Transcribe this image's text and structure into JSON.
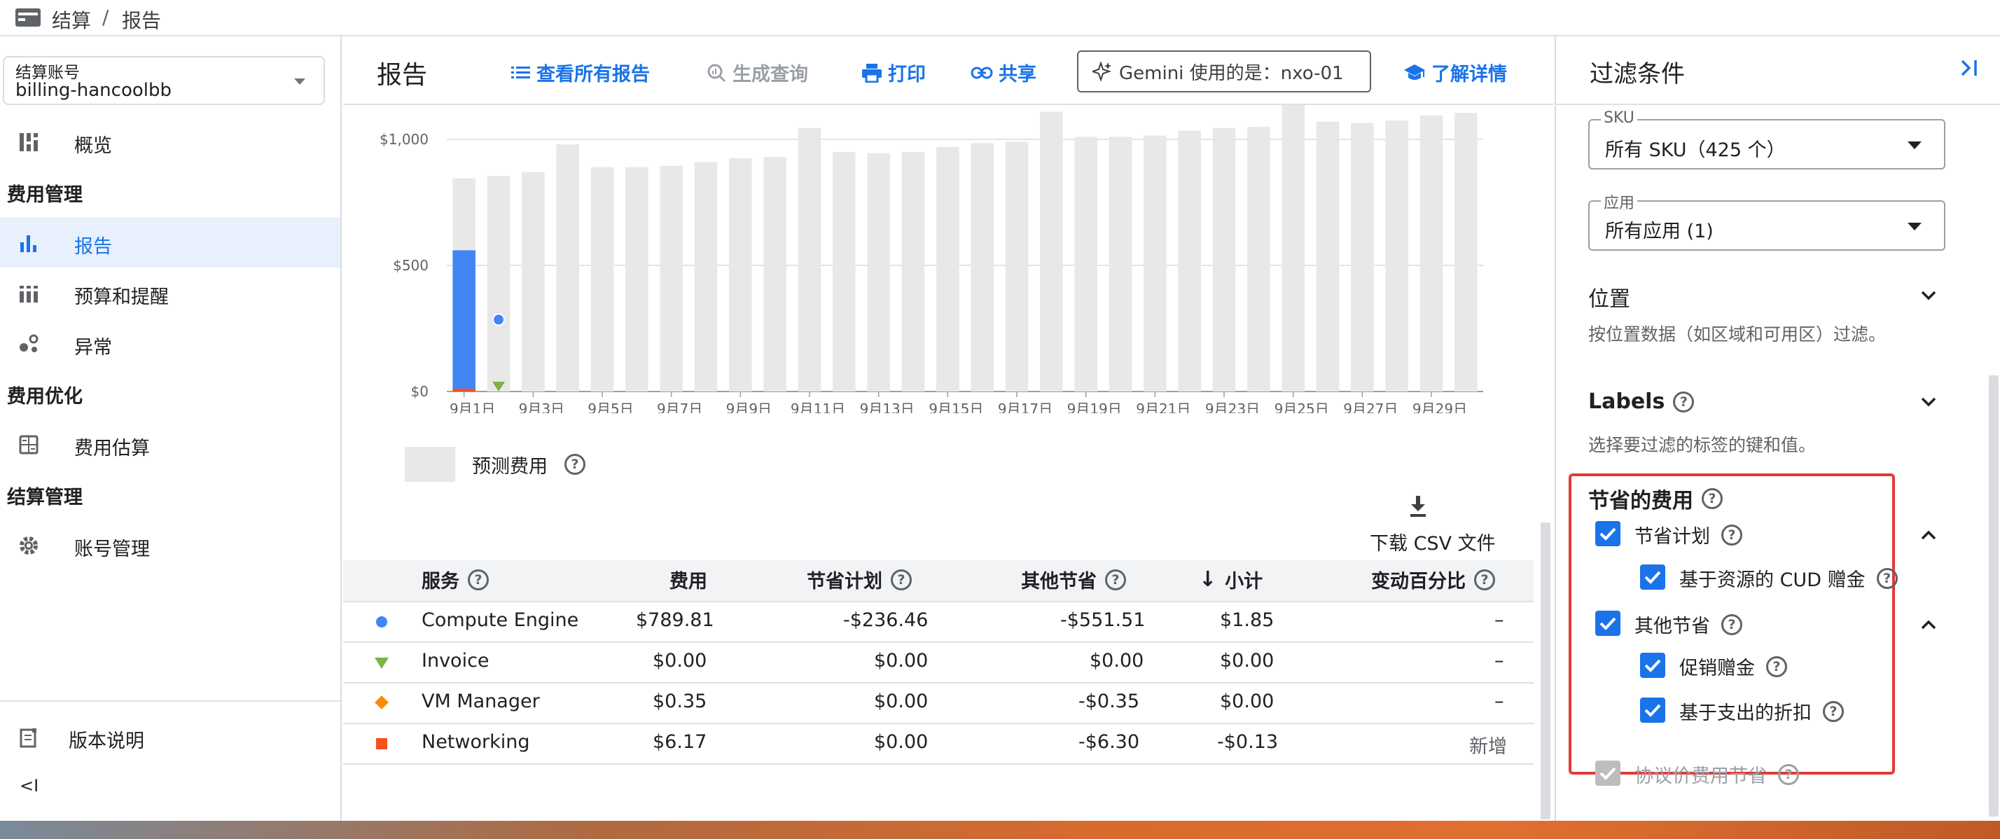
{
  "breadcrumb": {
    "root": "结算",
    "sep": "/",
    "current": "报告"
  },
  "account": {
    "label": "结算账号",
    "value": "billing-hancoolbb"
  },
  "nav": {
    "overview": "概览",
    "cost_mgmt": "费用管理",
    "reports": "报告",
    "budgets": "预算和提醒",
    "anomalies": "异常",
    "cost_opt": "费用优化",
    "estimate": "费用估算",
    "billing_mgmt": "结算管理",
    "account_mgmt": "账号管理",
    "release_notes": "版本说明",
    "collapse": "<I"
  },
  "header": {
    "title": "报告",
    "view_all": "查看所有报告",
    "gen_query": "生成查询",
    "print": "打印",
    "share": "共享",
    "gemini": "Gemini 使用的是：nxo-01",
    "learn_more": "了解详情"
  },
  "chart_data": {
    "type": "bar",
    "categories": [
      "9月1日",
      "9月2日",
      "9月3日",
      "9月4日",
      "9月5日",
      "9月6日",
      "9月7日",
      "9月8日",
      "9月9日",
      "9月10日",
      "9月11日",
      "9月12日",
      "9月13日",
      "9月14日",
      "9月15日",
      "9月16日",
      "9月17日",
      "9月18日",
      "9月19日",
      "9月20日",
      "9月21日",
      "9月22日",
      "9月23日",
      "9月24日",
      "9月25日",
      "9月26日",
      "9月27日",
      "9月28日",
      "9月29日",
      "9月30日"
    ],
    "x_ticks": [
      "9月1日",
      "9月3日",
      "9月5日",
      "9月7日",
      "9月9日",
      "9月11日",
      "9月13日",
      "9月15日",
      "9月17日",
      "9月19日",
      "9月21日",
      "9月23日",
      "9月25日",
      "9月27日",
      "9月29日"
    ],
    "y_ticks": [
      "$0",
      "$500",
      "$1,000"
    ],
    "ylim": [
      0,
      1100
    ],
    "series": [
      {
        "name": "预测费用",
        "color": "#e8e8e8",
        "values": [
          845,
          855,
          870,
          980,
          890,
          890,
          895,
          910,
          925,
          930,
          1045,
          950,
          945,
          950,
          970,
          985,
          990,
          1110,
          1010,
          1010,
          1015,
          1035,
          1045,
          1050,
          1140,
          1070,
          1065,
          1075,
          1095,
          1105
        ]
      },
      {
        "name": "Compute Engine",
        "color": "#4285f4",
        "values": [
          560,
          null,
          null,
          null,
          null,
          null,
          null,
          null,
          null,
          null,
          null,
          null,
          null,
          null,
          null,
          null,
          null,
          null,
          null,
          null,
          null,
          null,
          null,
          null,
          null,
          null,
          null,
          null,
          null,
          null
        ]
      }
    ],
    "marker_point": {
      "category": "9月2日",
      "value": 285
    },
    "legend": "预测费用"
  },
  "download": "下载 CSV 文件",
  "table": {
    "headers": {
      "service": "服务",
      "cost": "费用",
      "savings_plan": "节省计划",
      "other_savings": "其他节省",
      "subtotal": "小计",
      "change": "变动百分比"
    },
    "rows": [
      {
        "color": "#4285f4",
        "shape": "circle",
        "service": "Compute Engine",
        "cost": "$789.81",
        "savings_plan": "-$236.46",
        "other": "-$551.51",
        "subtotal": "$1.85",
        "change": "–"
      },
      {
        "color": "#7cb342",
        "shape": "triangle",
        "service": "Invoice",
        "cost": "$0.00",
        "savings_plan": "$0.00",
        "other": "$0.00",
        "subtotal": "$0.00",
        "change": "–"
      },
      {
        "color": "#fb8c00",
        "shape": "diamond",
        "service": "VM Manager",
        "cost": "$0.35",
        "savings_plan": "$0.00",
        "other": "-$0.35",
        "subtotal": "$0.00",
        "change": "–"
      },
      {
        "color": "#f4511e",
        "shape": "square",
        "service": "Networking",
        "cost": "$6.17",
        "savings_plan": "$0.00",
        "other": "-$6.30",
        "subtotal": "-$0.13",
        "change": "新增"
      }
    ]
  },
  "filters": {
    "title": "过滤条件",
    "sku_label": "SKU",
    "sku_value": "所有 SKU（425 个）",
    "app_label": "应用",
    "app_value": "所有应用 (1)",
    "location_title": "位置",
    "location_desc": "按位置数据（如区域和可用区）过滤。",
    "labels_title": "Labels",
    "labels_desc": "选择要过滤的标签的键和值。",
    "savings_title": "节省的费用",
    "savings_plan": "节省计划",
    "cud_credit": "基于资源的 CUD 赠金",
    "other_savings": "其他节省",
    "promo": "促销赠金",
    "spend_discount": "基于支出的折扣",
    "negotiated": "协议价费用节省"
  }
}
